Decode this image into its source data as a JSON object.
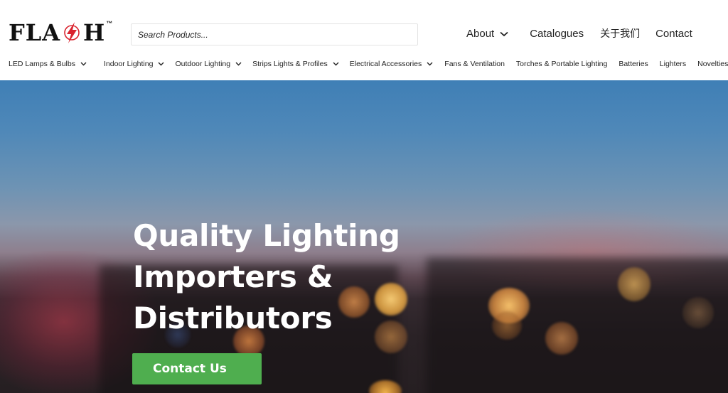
{
  "brand": {
    "logo_text_left": "FLA",
    "logo_text_right": "H",
    "logo_tm": "™"
  },
  "search": {
    "placeholder": "Search Products..."
  },
  "topnav": {
    "about": "About",
    "catalogues": "Catalogues",
    "chinese": "关于我们",
    "contact": "Contact"
  },
  "mainnav": {
    "items": [
      {
        "label": "LED Lamps & Bulbs",
        "has_dropdown": true
      },
      {
        "label": "Indoor Lighting",
        "has_dropdown": true
      },
      {
        "label": "Outdoor Lighting",
        "has_dropdown": true
      },
      {
        "label": "Strips Lights & Profiles",
        "has_dropdown": true
      },
      {
        "label": "Electrical Accessories",
        "has_dropdown": true
      },
      {
        "label": "Fans & Ventilation",
        "has_dropdown": false
      },
      {
        "label": "Torches & Portable Lighting",
        "has_dropdown": false
      },
      {
        "label": "Batteries",
        "has_dropdown": false
      },
      {
        "label": "Lighters",
        "has_dropdown": false
      },
      {
        "label": "Novelties",
        "has_dropdown": false
      }
    ]
  },
  "hero": {
    "title_line1": "Quality Lighting",
    "title_line2": "Importers &",
    "title_line3": "Distributors",
    "cta_label": "Contact Us"
  },
  "colors": {
    "cta_green": "#4fae4f",
    "logo_red": "#d9232e",
    "text_dark": "#222222"
  },
  "icons": {
    "logo_bolt": "lightning-bolt-icon",
    "dropdown": "chevron-down-icon"
  }
}
